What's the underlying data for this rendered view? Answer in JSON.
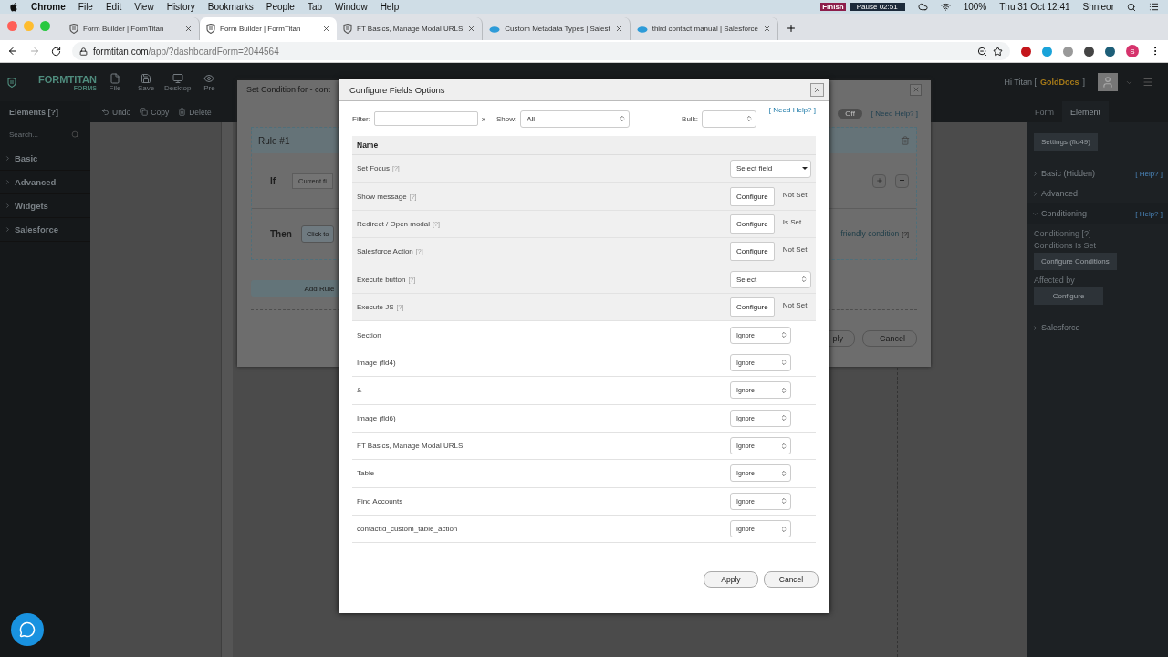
{
  "menubar": {
    "app": "Chrome",
    "menus": [
      "File",
      "Edit",
      "View",
      "History",
      "Bookmarks",
      "People",
      "Tab",
      "Window",
      "Help"
    ],
    "finish": "Finish",
    "pause": "Pause 02:51",
    "battery": "100%",
    "clock": "Thu 31 Oct  12:41",
    "user": "Shnieor"
  },
  "browser": {
    "tabs": [
      {
        "title": "Form Builder | FormTitan",
        "kind": "shield",
        "selected": false
      },
      {
        "title": "Form Builder | FormTitan",
        "kind": "shield",
        "selected": true
      },
      {
        "title": "FT Basics, Manage Modal URLS",
        "kind": "shield",
        "selected": false
      },
      {
        "title": "Custom Metadata Types | Salesf",
        "kind": "cloud",
        "selected": false
      },
      {
        "title": "third contact manual | Salesforce",
        "kind": "cloud",
        "selected": false
      }
    ],
    "url_host": "formtitan.com",
    "url_path": "/app/?dashboardForm=2044564",
    "profile": "S"
  },
  "app": {
    "logo": "FORMTITAN",
    "logo_sub": "FORMS",
    "toolbar": [
      "File",
      "Save",
      "Desktop",
      "Pre"
    ],
    "greeting": "Hi Titan [",
    "org": "GoldDocs",
    "greeting_end": "]",
    "elements_title": "Elements [?]",
    "search": {
      "placeholder": "Search..."
    },
    "categories": [
      "Basic",
      "Advanced",
      "Widgets",
      "Salesforce"
    ],
    "edit_tools": [
      "Undo",
      "Copy",
      "Delete"
    ],
    "right_tabs": [
      {
        "label": "Form",
        "selected": false
      },
      {
        "label": "Element",
        "selected": true
      }
    ],
    "settings_button": "Settings (fld49)",
    "sections": [
      {
        "label": "Basic (Hidden)",
        "help": "[ Help? ]",
        "expanded": false
      },
      {
        "label": "Advanced",
        "expanded": false
      },
      {
        "label": "Conditioning",
        "help": "[ Help? ]",
        "expanded": true
      },
      {
        "label": "Salesforce",
        "expanded": false
      }
    ],
    "conditioning": {
      "label": "Conditioning [?]",
      "status": "Conditions Is Set",
      "button": "Configure Conditions",
      "affected_label": "Affected by",
      "affected_button": "Configure"
    }
  },
  "condition_modal": {
    "title": "Set Condition for - cont",
    "toggle": {
      "label": "Off",
      "on": false
    },
    "help": "[ Need Help? ]",
    "rule_title": "Rule #1",
    "if_label": "If",
    "if_field": "Current fi",
    "then_label": "Then",
    "then_button": "Click to",
    "friendly_link": "friendly condition",
    "friendly_help": "[?]",
    "add_rule": "Add Rule",
    "apply": "ply",
    "cancel": "Cancel"
  },
  "fields_modal": {
    "title": "Configure Fields Options",
    "filter_label": "Filter:",
    "filter_clear": "x",
    "show_label": "Show:",
    "show_value": "All",
    "bulk_label": "Bulk:",
    "help": "[ Need Help? ]",
    "column": "Name",
    "rows": [
      {
        "name": "Set Focus",
        "help": "[?]",
        "kind": "select_field",
        "value": "Select field"
      },
      {
        "name": "Show message",
        "help": "[?]",
        "kind": "configure",
        "value": "Configure",
        "status": "Not Set"
      },
      {
        "name": "Redirect / Open modal",
        "help": "[?]",
        "kind": "configure",
        "value": "Configure",
        "status": "Is Set"
      },
      {
        "name": "Salesforce Action",
        "help": "[?]",
        "kind": "configure",
        "value": "Configure",
        "status": "Not Set"
      },
      {
        "name": "Execute button",
        "help": "[?]",
        "kind": "select",
        "value": "Select"
      },
      {
        "name": "Execute JS",
        "help": "[?]",
        "kind": "configure",
        "value": "Configure",
        "status": "Not Set"
      },
      {
        "name": "Section",
        "kind": "ignore",
        "value": "Ignore"
      },
      {
        "name": "Image (fld4)",
        "kind": "ignore",
        "value": "Ignore"
      },
      {
        "name": "&",
        "kind": "ignore",
        "value": "Ignore"
      },
      {
        "name": "Image (fld6)",
        "kind": "ignore",
        "value": "Ignore"
      },
      {
        "name": "FT Basics, Manage Modal URLS",
        "kind": "ignore",
        "value": "Ignore"
      },
      {
        "name": "Table",
        "kind": "ignore",
        "value": "Ignore"
      },
      {
        "name": "Find Accounts",
        "kind": "ignore",
        "value": "Ignore"
      },
      {
        "name": "contactId_custom_table_action",
        "kind": "ignore",
        "value": "Ignore"
      }
    ],
    "apply": "Apply",
    "cancel": "Cancel"
  }
}
